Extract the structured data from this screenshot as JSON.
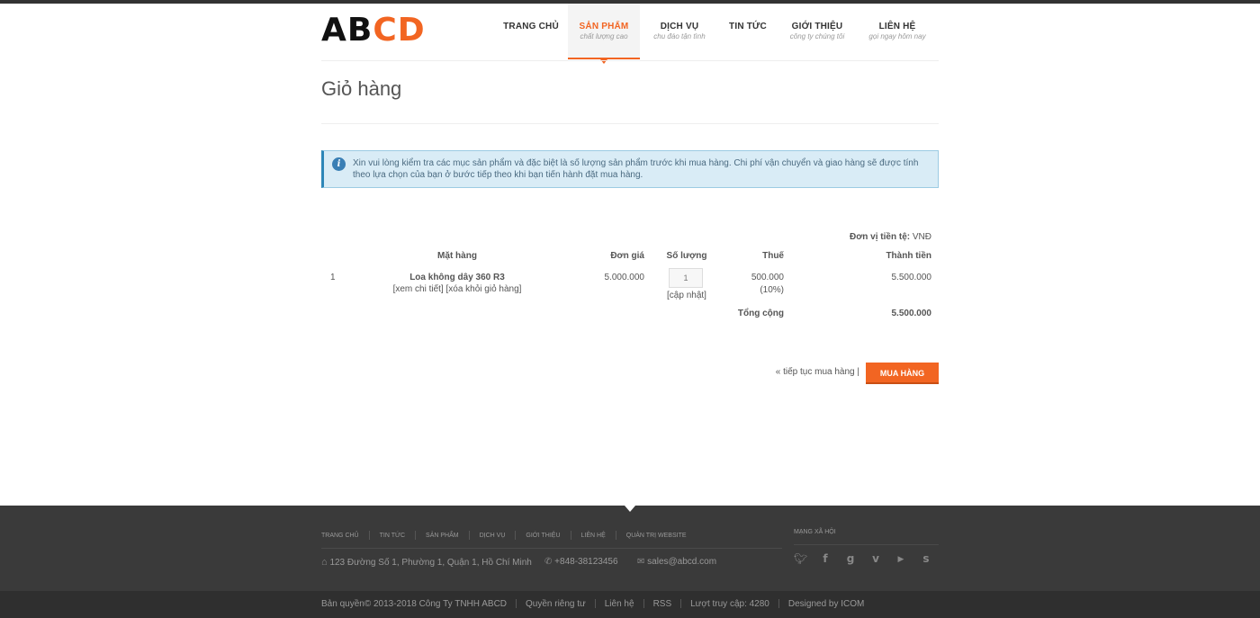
{
  "brand": {
    "logo_dark": "AB",
    "logo_accent": "CD"
  },
  "nav": [
    {
      "label": "TRANG CHỦ",
      "sub": ""
    },
    {
      "label": "SẢN PHẨM",
      "sub": "chất lượng cao"
    },
    {
      "label": "DỊCH VỤ",
      "sub": "chu đáo tận tình"
    },
    {
      "label": "TIN TỨC",
      "sub": ""
    },
    {
      "label": "GIỚI THIỆU",
      "sub": "công ty chúng tôi"
    },
    {
      "label": "LIÊN HỆ",
      "sub": "gọi ngay hôm nay"
    }
  ],
  "page": {
    "title": "Giỏ hàng"
  },
  "alert": {
    "text": "Xin vui lòng kiểm tra các mục sản phẩm và đặc biệt là số lượng sản phẩm trước khi mua hàng. Chi phí vận chuyển và giao hàng sẽ được tính theo lựa chọn của bạn ở bước tiếp theo khi bạn tiến hành đặt mua hàng."
  },
  "cart": {
    "currency_label": "Đơn vị tiền tệ:",
    "currency_value": " VNĐ",
    "headers": {
      "item": "Mặt hàng",
      "price": "Đơn giá",
      "qty": "Số lượng",
      "tax": "Thuế",
      "total": "Thành tiền"
    },
    "row": {
      "index": "1",
      "name": "Loa không dây 360 R3",
      "view": "[xem chi tiết]",
      "remove": "[xóa khỏi giỏ hàng]",
      "price": "5.000.000",
      "qty": "1",
      "update": "[cập nhật]",
      "tax": "500.000",
      "tax_rate": "(10%)",
      "total": "5.500.000"
    },
    "grand_label": "Tổng cộng",
    "grand_total": "5.500.000",
    "continue": "« tiếp tục mua hàng",
    "continue_sep": "|",
    "buy": "MUA HÀNG"
  },
  "footer": {
    "links": [
      "TRANG CHỦ",
      "TIN TỨC",
      "SẢN PHẨM",
      "DỊCH VỤ",
      "GIỚI THIỆU",
      "LIÊN HỆ",
      "QUẢN TRỊ WEBSITE"
    ],
    "address": "123 Đường Số 1, Phường 1, Quận 1, Hồ Chí Minh",
    "phone": "+848-38123456",
    "email": "sales@abcd.com",
    "social_title": "MẠNG XÃ HỘI",
    "social": [
      "twitter-icon",
      "facebook-icon",
      "google-icon",
      "vimeo-icon",
      "youtube-icon",
      "skype-icon"
    ],
    "copyright": "Bản quyền© 2013-2018 Công Ty TNHH ABCD",
    "privacy": "Quyền riêng tư",
    "contact": "Liên hệ",
    "rss": "RSS",
    "visits": "Lượt truy cập: 4280",
    "designed": "Designed by ICOM"
  },
  "colors": {
    "accent": "#f26522",
    "dark": "#333333",
    "footer": "#3a3a3a",
    "alert_bg": "#d9ecf6"
  }
}
